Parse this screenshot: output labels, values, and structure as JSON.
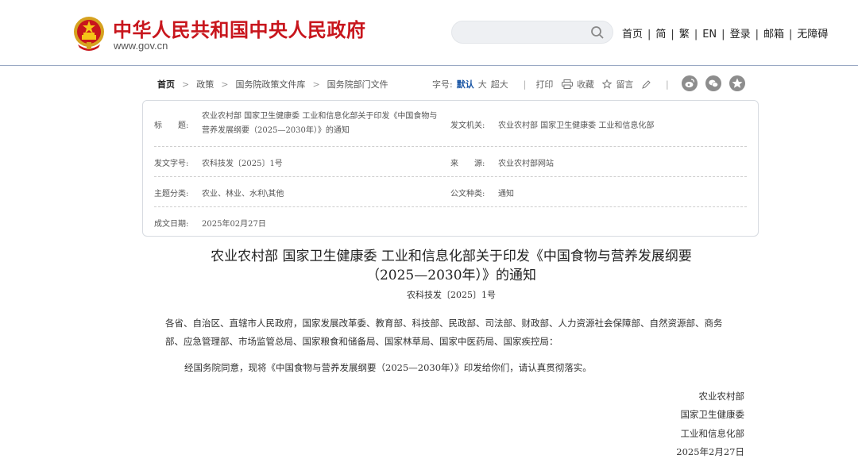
{
  "header": {
    "site_title": "中华人民共和国中央人民政府",
    "site_domain": "www.gov.cn",
    "search_placeholder": "",
    "nav": [
      "首页",
      "简",
      "繁",
      "EN",
      "登录",
      "邮箱",
      "无障碍"
    ]
  },
  "breadcrumb": [
    "首页",
    "政策",
    "国务院政策文件库",
    "国务院部门文件"
  ],
  "toolbar": {
    "font_size_label": "字号:",
    "font_sizes": [
      "默认",
      "大",
      "超大"
    ],
    "active_font_size": "默认",
    "print_label": "打印",
    "favorite_label": "收藏",
    "comment_label": "留言"
  },
  "info": {
    "title_label": "标　　题:",
    "title_value": "农业农村部 国家卫生健康委 工业和信息化部关于印发《中国食物与营养发展纲要（2025—2030年）》的通知",
    "issuer_label": "发文机关:",
    "issuer_value": "农业农村部 国家卫生健康委 工业和信息化部",
    "doc_number_label": "发文字号:",
    "doc_number_value": "农科技发〔2025〕1号",
    "source_label": "来　　源:",
    "source_value": "农业农村部网站",
    "subject_label": "主题分类:",
    "subject_value": "农业、林业、水利\\其他",
    "doc_type_label": "公文种类:",
    "doc_type_value": "通知",
    "date_label": "成文日期:",
    "date_value": "2025年02月27日"
  },
  "document": {
    "title_line1": "农业农村部 国家卫生健康委 工业和信息化部关于印发《中国食物与营养发展纲要",
    "title_line2": "（2025—2030年）》的通知",
    "number": "农科技发〔2025〕1号",
    "recipients": "各省、自治区、直辖市人民政府，国家发展改革委、教育部、科技部、民政部、司法部、财政部、人力资源社会保障部、自然资源部、商务部、应急管理部、市场监管总局、国家粮食和储备局、国家林草局、国家中医药局、国家疾控局：",
    "body": "经国务院同意，现将《中国食物与营养发展纲要（2025—2030年）》印发给你们，请认真贯彻落实。",
    "signatures": [
      "农业农村部",
      "国家卫生健康委",
      "工业和信息化部"
    ],
    "sign_date": "2025年2月27日"
  },
  "colors": {
    "brand_red": "#c8161d",
    "link_blue": "#1a56a5",
    "share_gray": "#8d8d8d"
  },
  "icons": [
    "national-emblem-icon",
    "search-icon",
    "print-icon",
    "star-icon",
    "pencil-icon",
    "weibo-icon",
    "wechat-icon",
    "qzone-icon"
  ]
}
